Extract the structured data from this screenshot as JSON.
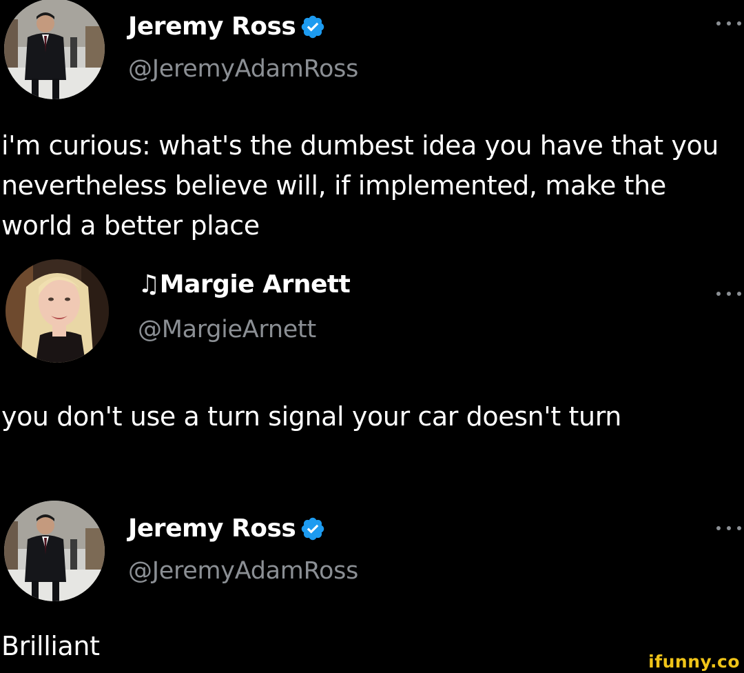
{
  "posts": [
    {
      "name": "Jeremy Ross",
      "handle": "@JeremyAdamRoss",
      "verified": true,
      "text": "i'm curious: what's the dumbest idea you have that you nevertheless believe will, if implemented, make the world a better place",
      "more_icon": "more-options-icon"
    },
    {
      "name": "♫Margie Arnett",
      "handle": "@MargieArnett",
      "verified": false,
      "text": "you don't use a turn signal your car doesn't turn",
      "more_icon": "more-options-icon"
    },
    {
      "name": "Jeremy Ross",
      "handle": "@JeremyAdamRoss",
      "verified": true,
      "text": "Brilliant",
      "more_icon": "more-options-icon"
    }
  ],
  "watermark": "ifunny.co",
  "colors": {
    "background": "#000000",
    "text": "#ffffff",
    "handle": "#8b8f94",
    "verified_badge": "#1d9bf0",
    "watermark": "#f0c419"
  }
}
